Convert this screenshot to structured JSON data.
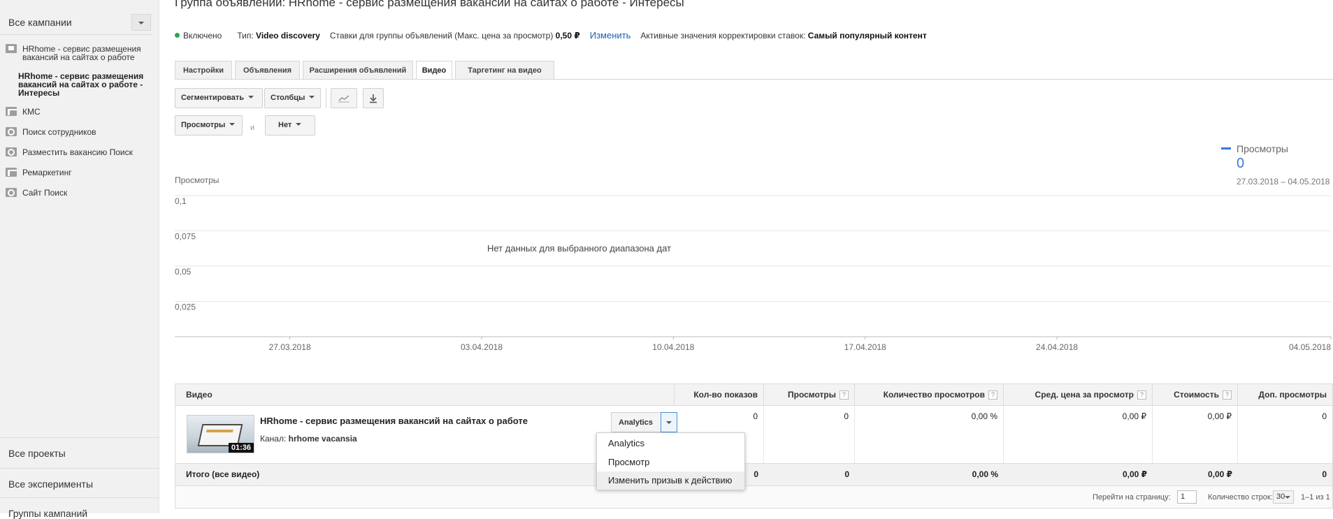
{
  "sidebar": {
    "campaign_select": "Все кампании",
    "items": [
      {
        "label": "HRhome - сервис размещения вакансий на сайтах о работе",
        "icon": "video-icon"
      },
      {
        "label": "КМС",
        "icon": "grid-icon"
      },
      {
        "label": "Поиск сотрудников",
        "icon": "search-icon"
      },
      {
        "label": "Разместить вакансию Поиск",
        "icon": "search-icon"
      },
      {
        "label": "Ремаркетинг",
        "icon": "grid-icon"
      },
      {
        "label": "Сайт Поиск",
        "icon": "search-icon"
      }
    ],
    "selected_ad_group": "HRhome - сервис размещения вакансий на сайтах о работе - Интересы",
    "bottom": [
      "Все проекты",
      "Все эксперименты",
      "Группы кампаний"
    ]
  },
  "header": {
    "title": "Группа объявлений: HRhome - сервис размещения вакансий на сайтах о работе - Интересы",
    "status": "Включено",
    "type_label": "Тип:",
    "type_value": "Video discovery",
    "bids_label": "Ставки для группы объявлений (Макс. цена за просмотр)",
    "bids_value": "0,50 ₽",
    "edit_link": "Изменить",
    "adjust_label": "Активные значения корректировки ставок:",
    "adjust_value": "Самый популярный контент",
    "status_color": "#2ea44f"
  },
  "tabs": [
    "Настройки",
    "Объявления",
    "Расширения объявлений",
    "Видео",
    "Таргетинг на видео"
  ],
  "active_tab": "Видео",
  "toolbar": {
    "segment": "Сегментировать",
    "columns": "Столбцы",
    "chart_icon": "line-chart-icon",
    "download_icon": "download-icon",
    "metric1": "Просмотры",
    "and": "и",
    "metric2": "Нет"
  },
  "chart_data": {
    "type": "line",
    "ylabel": "Просмотры",
    "yticks": [
      "0,1",
      "0,075",
      "0,05",
      "0,025"
    ],
    "ylim": [
      0,
      0.1
    ],
    "x": [
      "27.03.2018",
      "03.04.2018",
      "10.04.2018",
      "17.04.2018",
      "24.04.2018",
      "04.05.2018"
    ],
    "series": [
      {
        "name": "Просмотры",
        "values": []
      }
    ],
    "legend": {
      "name": "Просмотры",
      "value": "0",
      "range": "27.03.2018 – 04.05.2018",
      "placement": "top-right"
    },
    "annotation": "Нет данных для выбранного диапазона дат",
    "grid": true,
    "series_color": "#3a78d6"
  },
  "table": {
    "headers": [
      "Видео",
      "Кол-во показов",
      "Просмотры",
      "Количество просмотров",
      "Сред. цена за просмотр",
      "Стоимость",
      "Доп. просмотры"
    ],
    "row": {
      "title": "HRhome - сервис размещения вакансий на сайтах о работе",
      "channel_label": "Канал:",
      "channel": "hrhome vacansia",
      "duration": "01:36",
      "button": "Analytics",
      "values": [
        "0",
        "0",
        "0,00 %",
        "0,00 ₽",
        "0,00 ₽",
        "0"
      ]
    },
    "total": {
      "label": "Итого (все видео)",
      "values": [
        "0",
        "0",
        "0,00 %",
        "0,00 ₽",
        "0,00 ₽",
        "0"
      ]
    },
    "pager": {
      "goto_label": "Перейти на страницу:",
      "page": "1",
      "rows_label": "Количество строк:",
      "rows": "30",
      "range": "1–1 из 1"
    }
  },
  "menu": {
    "items": [
      "Analytics",
      "Просмотр",
      "Изменить призыв к действию"
    ]
  }
}
